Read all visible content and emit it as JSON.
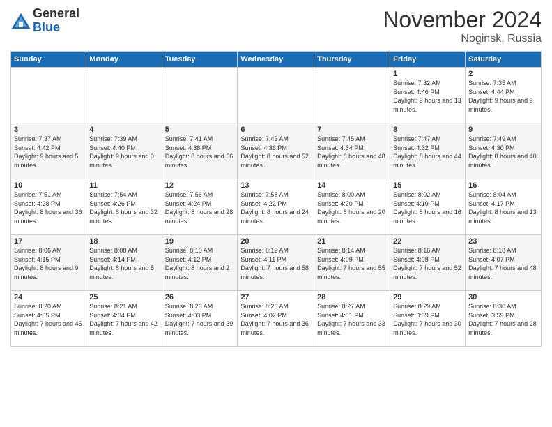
{
  "header": {
    "logo_general": "General",
    "logo_blue": "Blue",
    "month_year": "November 2024",
    "location": "Noginsk, Russia"
  },
  "weekdays": [
    "Sunday",
    "Monday",
    "Tuesday",
    "Wednesday",
    "Thursday",
    "Friday",
    "Saturday"
  ],
  "weeks": [
    [
      {
        "day": "",
        "info": ""
      },
      {
        "day": "",
        "info": ""
      },
      {
        "day": "",
        "info": ""
      },
      {
        "day": "",
        "info": ""
      },
      {
        "day": "",
        "info": ""
      },
      {
        "day": "1",
        "info": "Sunrise: 7:32 AM\nSunset: 4:46 PM\nDaylight: 9 hours and 13 minutes."
      },
      {
        "day": "2",
        "info": "Sunrise: 7:35 AM\nSunset: 4:44 PM\nDaylight: 9 hours and 9 minutes."
      }
    ],
    [
      {
        "day": "3",
        "info": "Sunrise: 7:37 AM\nSunset: 4:42 PM\nDaylight: 9 hours and 5 minutes."
      },
      {
        "day": "4",
        "info": "Sunrise: 7:39 AM\nSunset: 4:40 PM\nDaylight: 9 hours and 0 minutes."
      },
      {
        "day": "5",
        "info": "Sunrise: 7:41 AM\nSunset: 4:38 PM\nDaylight: 8 hours and 56 minutes."
      },
      {
        "day": "6",
        "info": "Sunrise: 7:43 AM\nSunset: 4:36 PM\nDaylight: 8 hours and 52 minutes."
      },
      {
        "day": "7",
        "info": "Sunrise: 7:45 AM\nSunset: 4:34 PM\nDaylight: 8 hours and 48 minutes."
      },
      {
        "day": "8",
        "info": "Sunrise: 7:47 AM\nSunset: 4:32 PM\nDaylight: 8 hours and 44 minutes."
      },
      {
        "day": "9",
        "info": "Sunrise: 7:49 AM\nSunset: 4:30 PM\nDaylight: 8 hours and 40 minutes."
      }
    ],
    [
      {
        "day": "10",
        "info": "Sunrise: 7:51 AM\nSunset: 4:28 PM\nDaylight: 8 hours and 36 minutes."
      },
      {
        "day": "11",
        "info": "Sunrise: 7:54 AM\nSunset: 4:26 PM\nDaylight: 8 hours and 32 minutes."
      },
      {
        "day": "12",
        "info": "Sunrise: 7:56 AM\nSunset: 4:24 PM\nDaylight: 8 hours and 28 minutes."
      },
      {
        "day": "13",
        "info": "Sunrise: 7:58 AM\nSunset: 4:22 PM\nDaylight: 8 hours and 24 minutes."
      },
      {
        "day": "14",
        "info": "Sunrise: 8:00 AM\nSunset: 4:20 PM\nDaylight: 8 hours and 20 minutes."
      },
      {
        "day": "15",
        "info": "Sunrise: 8:02 AM\nSunset: 4:19 PM\nDaylight: 8 hours and 16 minutes."
      },
      {
        "day": "16",
        "info": "Sunrise: 8:04 AM\nSunset: 4:17 PM\nDaylight: 8 hours and 13 minutes."
      }
    ],
    [
      {
        "day": "17",
        "info": "Sunrise: 8:06 AM\nSunset: 4:15 PM\nDaylight: 8 hours and 9 minutes."
      },
      {
        "day": "18",
        "info": "Sunrise: 8:08 AM\nSunset: 4:14 PM\nDaylight: 8 hours and 5 minutes."
      },
      {
        "day": "19",
        "info": "Sunrise: 8:10 AM\nSunset: 4:12 PM\nDaylight: 8 hours and 2 minutes."
      },
      {
        "day": "20",
        "info": "Sunrise: 8:12 AM\nSunset: 4:11 PM\nDaylight: 7 hours and 58 minutes."
      },
      {
        "day": "21",
        "info": "Sunrise: 8:14 AM\nSunset: 4:09 PM\nDaylight: 7 hours and 55 minutes."
      },
      {
        "day": "22",
        "info": "Sunrise: 8:16 AM\nSunset: 4:08 PM\nDaylight: 7 hours and 52 minutes."
      },
      {
        "day": "23",
        "info": "Sunrise: 8:18 AM\nSunset: 4:07 PM\nDaylight: 7 hours and 48 minutes."
      }
    ],
    [
      {
        "day": "24",
        "info": "Sunrise: 8:20 AM\nSunset: 4:05 PM\nDaylight: 7 hours and 45 minutes."
      },
      {
        "day": "25",
        "info": "Sunrise: 8:21 AM\nSunset: 4:04 PM\nDaylight: 7 hours and 42 minutes."
      },
      {
        "day": "26",
        "info": "Sunrise: 8:23 AM\nSunset: 4:03 PM\nDaylight: 7 hours and 39 minutes."
      },
      {
        "day": "27",
        "info": "Sunrise: 8:25 AM\nSunset: 4:02 PM\nDaylight: 7 hours and 36 minutes."
      },
      {
        "day": "28",
        "info": "Sunrise: 8:27 AM\nSunset: 4:01 PM\nDaylight: 7 hours and 33 minutes."
      },
      {
        "day": "29",
        "info": "Sunrise: 8:29 AM\nSunset: 3:59 PM\nDaylight: 7 hours and 30 minutes."
      },
      {
        "day": "30",
        "info": "Sunrise: 8:30 AM\nSunset: 3:59 PM\nDaylight: 7 hours and 28 minutes."
      }
    ]
  ]
}
